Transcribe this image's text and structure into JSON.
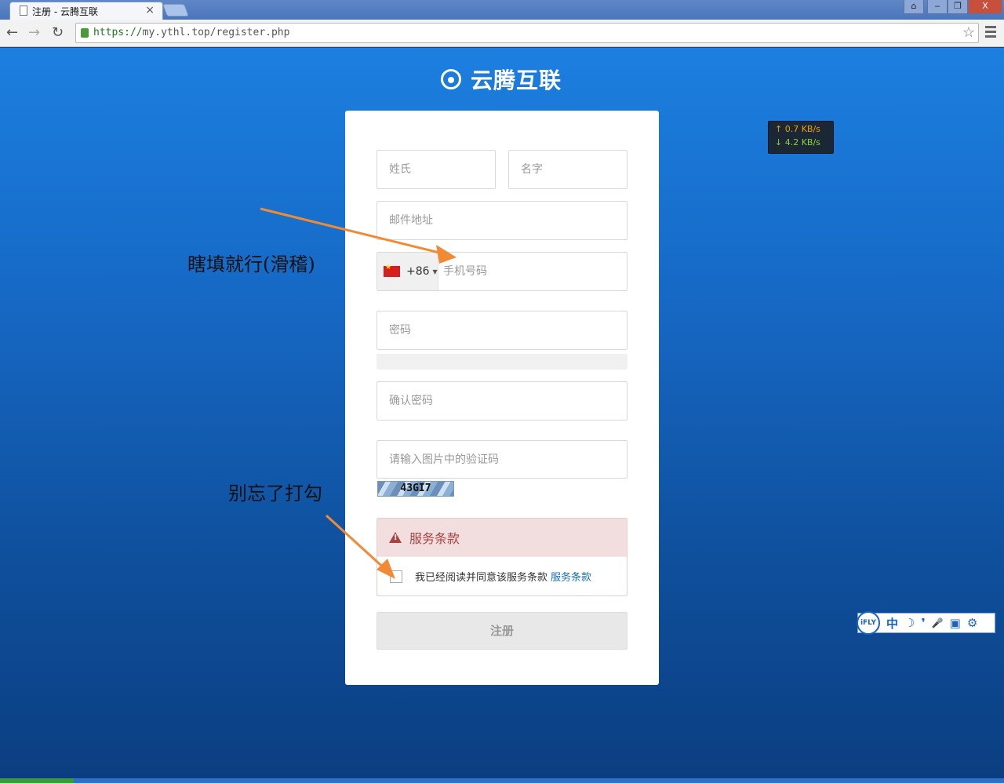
{
  "browser": {
    "tab_title": "注册 - 云腾互联",
    "tab_close": "×",
    "url_scheme": "https://",
    "url_rest": "my.ythl.top/register.php",
    "window_controls": [
      "⌂",
      "‒",
      "❐",
      "X"
    ]
  },
  "brand": {
    "name": "云腾互联"
  },
  "form": {
    "last_name_placeholder": "姓氏",
    "first_name_placeholder": "名字",
    "email_placeholder": "邮件地址",
    "country_code": "+86",
    "phone_placeholder": "手机号码",
    "password_placeholder": "密码",
    "confirm_password_placeholder": "确认密码",
    "captcha_placeholder": "请输入图片中的验证码",
    "captcha_text": "43GI7",
    "terms_title": "服务条款",
    "terms_agree_text": "我已经阅读并同意该服务条款",
    "terms_link": "服务条款",
    "submit_label": "注册"
  },
  "annotations": {
    "phone_note": "瞎填就行(滑稽)",
    "checkbox_note": "别忘了打勾"
  },
  "net_meter": {
    "upload": "↑ 0.7 KB/s",
    "download": "↓ 4.2 KB/s"
  },
  "ime": {
    "logo": "iFLY",
    "mode": "中",
    "items": [
      "☽",
      "❜",
      "🎤",
      "▣",
      "⚙"
    ]
  },
  "colors": {
    "accent": "#1a6fb8",
    "warning_bg": "#f2dede",
    "warning_text": "#a94442",
    "arrow": "#f08a35"
  }
}
